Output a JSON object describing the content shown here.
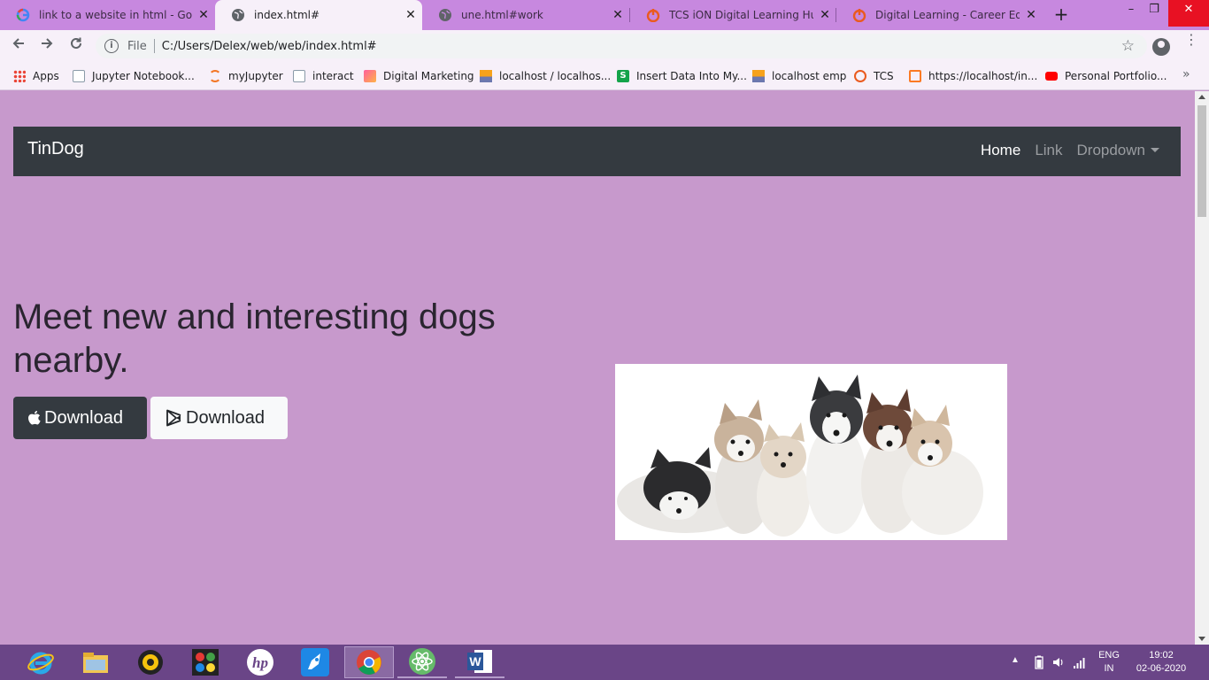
{
  "browser": {
    "tabs": [
      {
        "title": "link to a website in html - Goog",
        "favicon": "google-icon"
      },
      {
        "title": "index.html#",
        "favicon": "globe-icon",
        "active": true
      },
      {
        "title": "une.html#work",
        "favicon": "globe-icon"
      },
      {
        "title": "TCS iON Digital Learning Hub",
        "favicon": "tcs-icon"
      },
      {
        "title": "Digital Learning - Career Edge -",
        "favicon": "tcs-icon"
      }
    ],
    "new_tab_label": "+",
    "omnibox": {
      "scheme_label": "File",
      "url": "C:/Users/Delex/web/web/index.html#"
    },
    "bookmarks": [
      {
        "label": "Apps",
        "icon": "apps-grid-icon"
      },
      {
        "label": "Jupyter Notebook...",
        "icon": "notebook-icon"
      },
      {
        "label": "myJupyter",
        "icon": "jupyter-icon"
      },
      {
        "label": "interact",
        "icon": "notebook-icon"
      },
      {
        "label": "Digital Marketing",
        "icon": "chart-icon"
      },
      {
        "label": "localhost / localhos...",
        "icon": "phpmyadmin-icon"
      },
      {
        "label": "Insert Data Into My...",
        "icon": "s-icon"
      },
      {
        "label": "localhost emp",
        "icon": "phpmyadmin-icon"
      },
      {
        "label": "TCS",
        "icon": "tcs-icon"
      },
      {
        "label": "https://localhost/in...",
        "icon": "xampp-icon"
      },
      {
        "label": "Personal Portfolio...",
        "icon": "youtube-icon"
      }
    ],
    "bookmarks_more": "»"
  },
  "page": {
    "navbar": {
      "brand": "TinDog",
      "links": {
        "home": "Home",
        "link": "Link",
        "dropdown": "Dropdown"
      }
    },
    "headline": "Meet new and interesting dogs nearby.",
    "buttons": {
      "apple": "Download",
      "google_play": "Download"
    },
    "hero_image": "husky-puppies-image",
    "background_color": "#c799cc",
    "navbar_color": "#343a40"
  },
  "taskbar": {
    "apps": [
      "ie-icon",
      "file-explorer-icon",
      "media-player-icon",
      "paint-icon",
      "hp-icon",
      "rocket-icon",
      "chrome-icon",
      "atom-icon",
      "word-icon"
    ],
    "tray": {
      "language_top": "ENG",
      "language_bottom": "IN",
      "time": "19:02",
      "date": "02-06-2020"
    }
  }
}
